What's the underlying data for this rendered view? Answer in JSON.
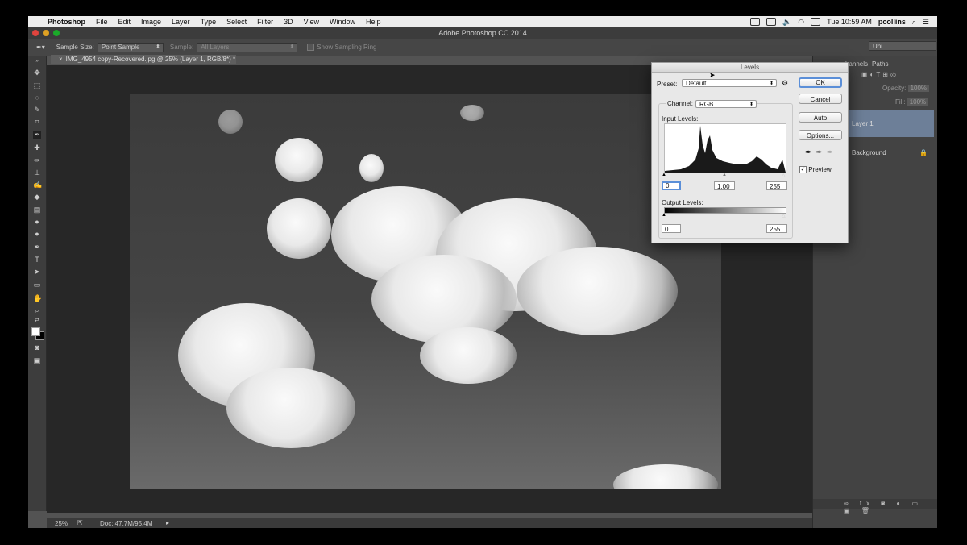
{
  "menubar": {
    "app_name": "Photoshop",
    "items": [
      "File",
      "Edit",
      "Image",
      "Layer",
      "Type",
      "Select",
      "Filter",
      "3D",
      "View",
      "Window",
      "Help"
    ],
    "clock": "Tue 10:59 AM",
    "user": "pcollins"
  },
  "window": {
    "title": "Adobe Photoshop CC 2014"
  },
  "options_bar": {
    "sample_size_label": "Sample Size:",
    "sample_size_value": "Point Sample",
    "sample_label": "Sample:",
    "sample_value": "All Layers",
    "show_ring_label": "Show Sampling Ring",
    "workspace": "Uni"
  },
  "document": {
    "tab_label": "IMG_4954 copy-Recovered.jpg @ 25% (Layer 1, RGB/8*) *"
  },
  "status_bar": {
    "zoom": "25%",
    "doc_size": "Doc: 47.7M/95.4M"
  },
  "layers_panel": {
    "tabs": [
      "hannels",
      "Paths"
    ],
    "opacity_label": "Opacity:",
    "opacity_value": "100%",
    "fill_label": "Fill:",
    "fill_value": "100%",
    "layers": [
      {
        "name": "Layer 1",
        "selected": true
      },
      {
        "name": "Background",
        "selected": false
      }
    ]
  },
  "levels_dialog": {
    "title": "Levels",
    "preset_label": "Preset:",
    "preset_value": "Default",
    "channel_label": "Channel:",
    "channel_value": "RGB",
    "input_levels_label": "Input Levels:",
    "input_black": "0",
    "input_gamma": "1.00",
    "input_white": "255",
    "output_levels_label": "Output Levels:",
    "output_black": "0",
    "output_white": "255",
    "buttons": {
      "ok": "OK",
      "cancel": "Cancel",
      "auto": "Auto",
      "options": "Options..."
    },
    "preview_label": "Preview",
    "preview_checked": true
  },
  "colors": {
    "accent": "#5b8fd8",
    "selected_layer": "#6d7f98",
    "ui_dark": "#535353"
  }
}
